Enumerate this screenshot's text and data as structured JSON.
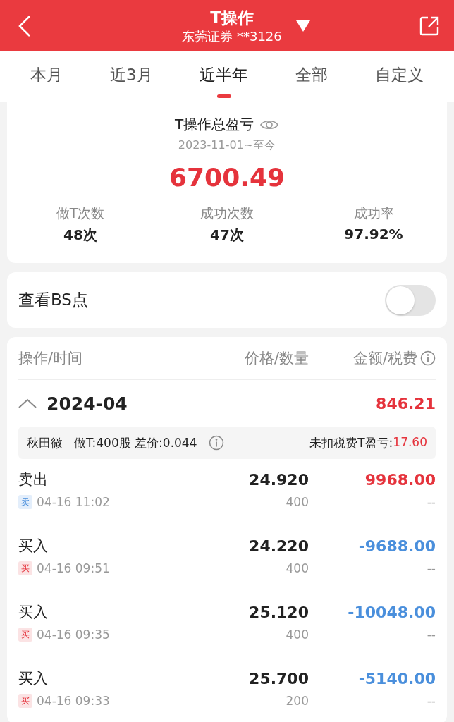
{
  "header": {
    "title": "T操作",
    "subtitle": "东莞证券 **3126"
  },
  "tabs": [
    {
      "label": "本月",
      "selected": false
    },
    {
      "label": "近3月",
      "selected": false
    },
    {
      "label": "近半年",
      "selected": true
    },
    {
      "label": "全部",
      "selected": false
    },
    {
      "label": "自定义",
      "selected": false
    }
  ],
  "summary": {
    "title": "T操作总盈亏",
    "period": "2023-11-01~至今",
    "total": "6700.49",
    "stats": [
      {
        "label": "做T次数",
        "value": "48次"
      },
      {
        "label": "成功次数",
        "value": "47次"
      },
      {
        "label": "成功率",
        "value": "97.92%"
      }
    ]
  },
  "bs_toggle": {
    "label": "查看BS点",
    "on": false
  },
  "table": {
    "columns": [
      "操作/时间",
      "价格/数量",
      "金额/税费"
    ],
    "groups": [
      {
        "month": "2024-04",
        "expanded": true,
        "total": "846.21",
        "stock": {
          "name": "秋田微",
          "detail": "做T:400股 差价:0.044",
          "profit_label": "未扣税费T盈亏:",
          "profit": "17.60"
        },
        "trades": [
          {
            "kind": "sell",
            "action": "卖出",
            "badge": "卖",
            "time": "04-16 11:02",
            "price": "24.920",
            "quantity": "400",
            "amount": "9968.00",
            "fee": "--"
          },
          {
            "kind": "buy",
            "action": "买入",
            "badge": "买",
            "time": "04-16 09:51",
            "price": "24.220",
            "quantity": "400",
            "amount": "-9688.00",
            "fee": "--"
          },
          {
            "kind": "buy",
            "action": "买入",
            "badge": "买",
            "time": "04-16 09:35",
            "price": "25.120",
            "quantity": "400",
            "amount": "-10048.00",
            "fee": "--"
          },
          {
            "kind": "buy",
            "action": "买入",
            "badge": "买",
            "time": "04-16 09:33",
            "price": "25.700",
            "quantity": "200",
            "amount": "-5140.00",
            "fee": "--"
          }
        ]
      }
    ]
  }
}
